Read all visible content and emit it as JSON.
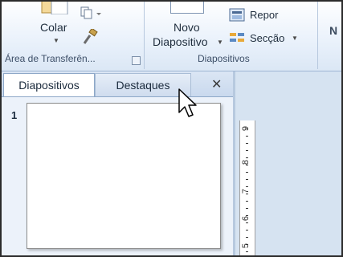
{
  "ribbon": {
    "clipboard": {
      "paste_label": "Colar",
      "group_label": "Área de Transferên..."
    },
    "slides": {
      "new_slide_line1": "Novo",
      "new_slide_line2": "Diapositivo",
      "reset_label": "Repor",
      "section_label": "Secção",
      "group_label": "Diapositivos"
    },
    "next_group_partial": "N"
  },
  "pane": {
    "tabs": [
      {
        "label": "Diapositivos",
        "active": true
      },
      {
        "label": "Destaques",
        "active": false
      }
    ],
    "close_symbol": "✕",
    "slide_number": "1"
  },
  "ruler": {
    "labels": [
      "9",
      "8",
      "7",
      "6",
      "5"
    ]
  },
  "colors": {
    "ribbon_bg": "#e9f1fb",
    "pane_bg": "#ecf2fa",
    "tab_active": "#ffffff",
    "group_text": "#3d4f68"
  }
}
